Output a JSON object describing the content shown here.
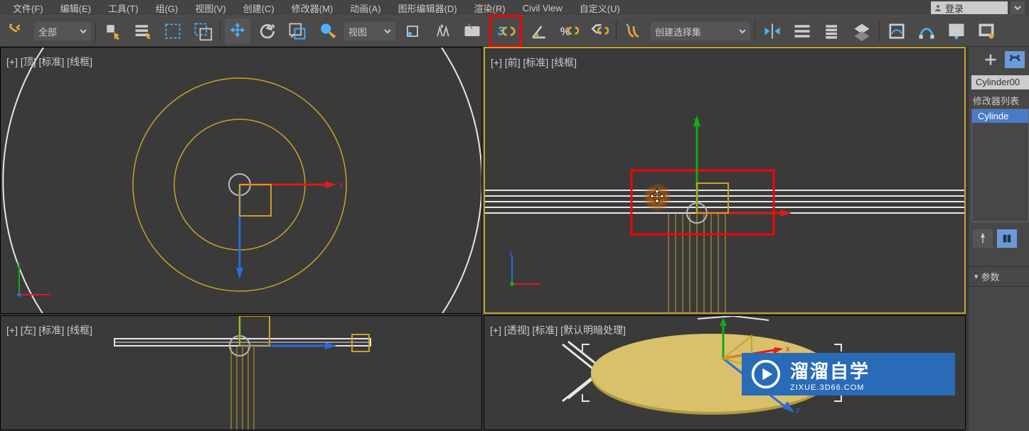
{
  "menu": {
    "file": "文件(F)",
    "edit": "编辑(E)",
    "tools": "工具(T)",
    "group": "组(G)",
    "views": "视图(V)",
    "create": "创建(C)",
    "modifiers": "修改器(M)",
    "animation": "动画(A)",
    "graph": "图形编辑器(D)",
    "render": "渲染(R)",
    "civil": "Civil View",
    "customize": "自定义(U)",
    "login": "登录"
  },
  "toolbar": {
    "filter_all": "全部",
    "refsys": "视图",
    "selection_set": "创建选择集"
  },
  "viewports": {
    "top": "[+] [顶] [标准] [线框]",
    "front": "[+] [前] [标准] [线框]",
    "left": "[+] [左] [标准] [线框]",
    "persp": "[+] [透视] [标准] [默认明暗处理]"
  },
  "side": {
    "object_name": "Cylinder00",
    "modifier_label": "修改器列表",
    "stack_item": "Cylinde",
    "rollout_params": "参数"
  },
  "watermark": {
    "title": "溜溜自学",
    "url": "ZIXUE.3D66.COM"
  },
  "axes": {
    "x": "x",
    "y": "y",
    "z": "z"
  }
}
